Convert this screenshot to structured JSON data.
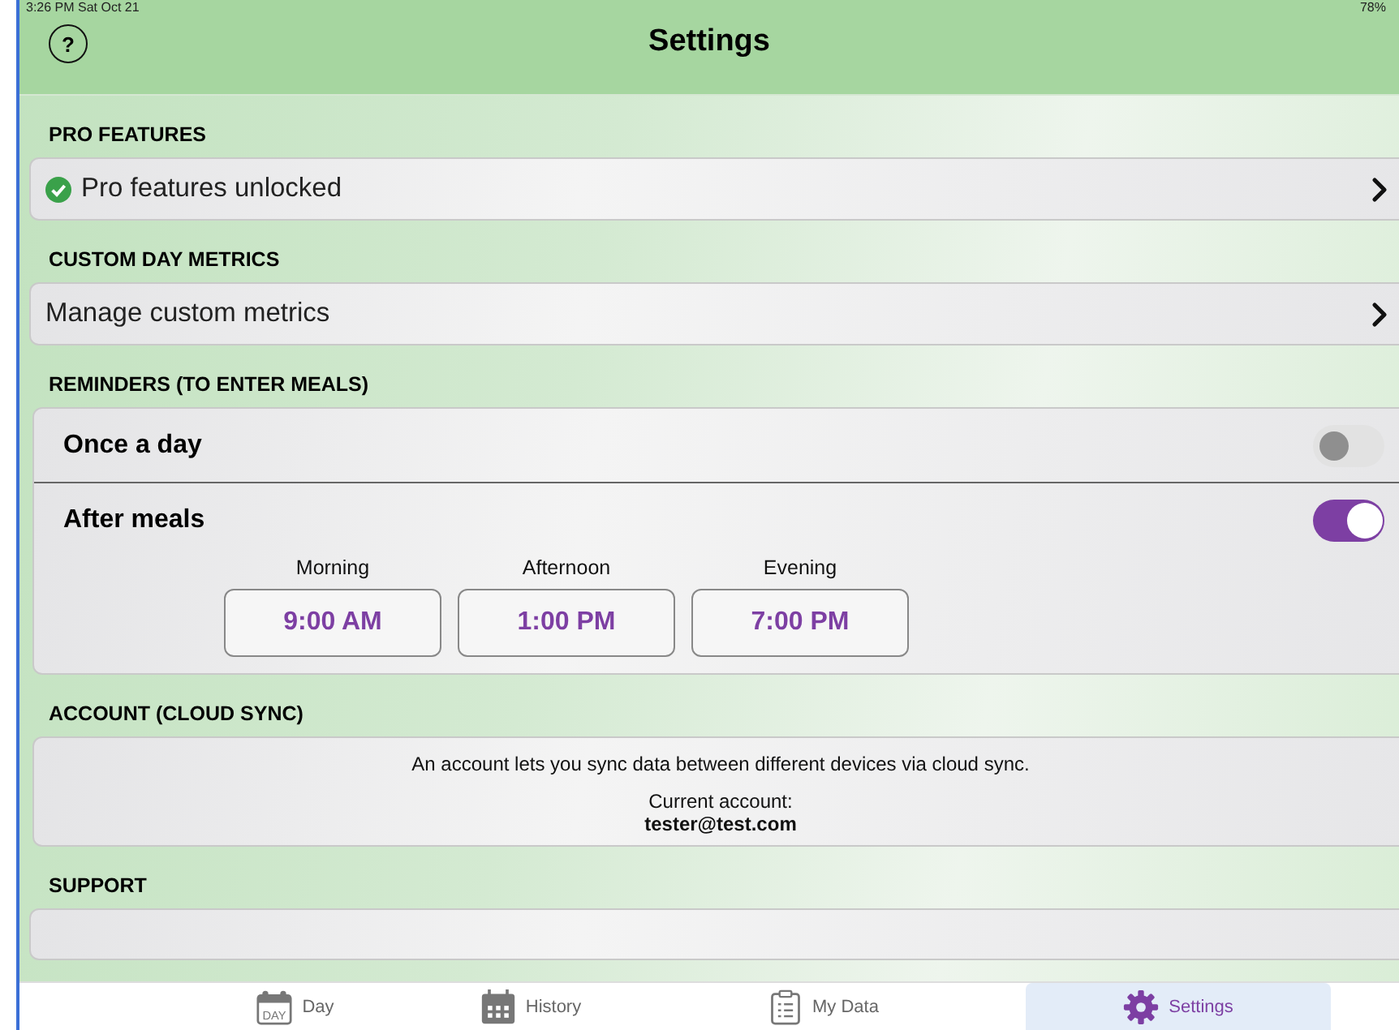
{
  "status_bar": {
    "time": "3:26 PM  Sat Oct 21",
    "battery": "78%"
  },
  "header": {
    "title": "Settings",
    "help": "?"
  },
  "pro": {
    "heading": "PRO FEATURES",
    "label": "Pro features unlocked",
    "checked": true
  },
  "custom": {
    "heading": "CUSTOM DAY METRICS",
    "label": "Manage custom metrics"
  },
  "reminders": {
    "heading": "REMINDERS (TO ENTER MEALS)",
    "options": [
      {
        "label": "Once a day",
        "on": false
      },
      {
        "label": "After meals",
        "on": true
      }
    ],
    "times": [
      {
        "label": "Morning",
        "value": "9:00 AM"
      },
      {
        "label": "Afternoon",
        "value": "1:00 PM"
      },
      {
        "label": "Evening",
        "value": "7:00 PM"
      }
    ]
  },
  "account": {
    "heading": "ACCOUNT (CLOUD SYNC)",
    "description": "An account lets you sync data between different devices via cloud sync.",
    "current_label": "Current account:",
    "email": "tester@test.com"
  },
  "support": {
    "heading": "SUPPORT"
  },
  "tabs": [
    {
      "label": "Day",
      "kind": "day",
      "icon_text": "DAY",
      "selected": false
    },
    {
      "label": "History",
      "kind": "history",
      "selected": false
    },
    {
      "label": "My Data",
      "kind": "data",
      "selected": false
    },
    {
      "label": "Settings",
      "kind": "settings",
      "selected": true
    }
  ]
}
